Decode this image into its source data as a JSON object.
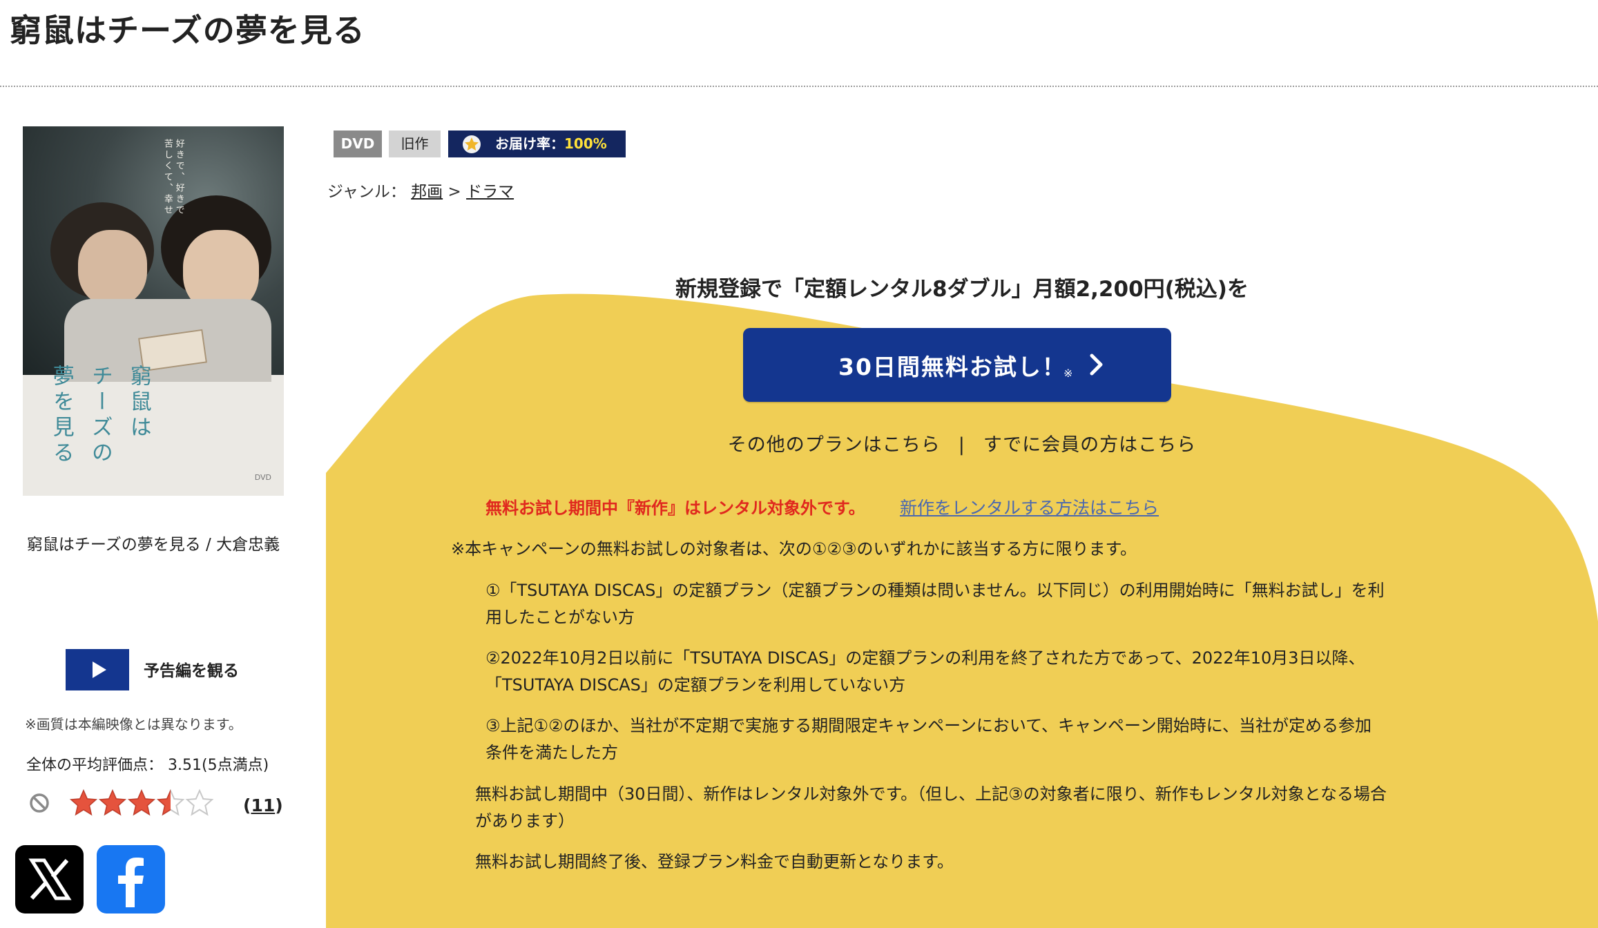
{
  "page": {
    "title": "窮鼠はチーズの夢を見る"
  },
  "product": {
    "cover": {
      "title_col1": "窮鼠は",
      "title_col2": "チーズの",
      "title_col3": "夢を見る",
      "tagline_col1": "好きで、好きで",
      "tagline_col2": "苦しくて、幸せ",
      "dvd_mark": "DVD"
    },
    "name": "窮鼠はチーズの夢を見る / 大倉忠義",
    "trailer_label": "予告編を観る",
    "quality_note": "※画質は本編映像とは異なります。",
    "rating_label": "全体の平均評価点：",
    "rating_value": "3.51(5点満点)",
    "rating_stars": 3.5,
    "review_count_open": "(",
    "review_count": "11",
    "review_count_close": ")"
  },
  "share": {
    "x_icon": "x-logo-icon",
    "facebook_icon": "facebook-logo-icon"
  },
  "badges": {
    "dvd": "DVD",
    "old": "旧作",
    "delivery_label": "お届け率：",
    "delivery_value": "100%"
  },
  "genre": {
    "label": "ジャンル：",
    "items": [
      "邦画",
      "ドラマ"
    ],
    "separator": " > "
  },
  "promo": {
    "headline": "新規登録で「定額レンタル8ダブル」月額2,200円(税込)を",
    "trial_button": "30日間無料お試し！",
    "trial_asterisk": "※",
    "other_plans": "その他のプランはこちら",
    "divider": "|",
    "members": "すでに会員の方はこちら",
    "warning": "無料お試し期間中『新作』はレンタル対象外です。",
    "warning_link": "新作をレンタルする方法はこちら",
    "conditions_intro": "※本キャンペーンの無料お試しの対象者は、次の①②③のいずれかに該当する方に限ります。",
    "condition1_a": "①「TSUTAYA DISCAS」の定額プラン（定額プランの種類は問いません。以下同じ）の利用開始時に「無料お試し」を利",
    "condition1_b": "用したことがない方",
    "condition2_a": "②2022年10月2日以前に「TSUTAYA DISCAS」の定額プランの利用を終了された方であって、2022年10月3日以降、",
    "condition2_b": "「TSUTAYA DISCAS」の定額プランを利用していない方",
    "condition3_a": "③上記①②のほか、当社が不定期で実施する期間限定キャンペーンにおいて、キャンペーン開始時に、当社が定める参加",
    "condition3_b": "条件を満たした方",
    "note1_a": "無料お試し期間中（30日間）、新作はレンタル対象外です。（但し、上記③の対象者に限り、新作もレンタル対象となる場合",
    "note1_b": "があります）",
    "note2": "無料お試し期間終了後、登録プラン料金で自動更新となります。"
  },
  "colors": {
    "brand_blue": "#14368f",
    "promo_yellow": "#f0ce55",
    "warning_red": "#e0281e",
    "link_blue": "#4a68b0",
    "badge_navy": "#14265f",
    "star_red": "#e5533d"
  }
}
